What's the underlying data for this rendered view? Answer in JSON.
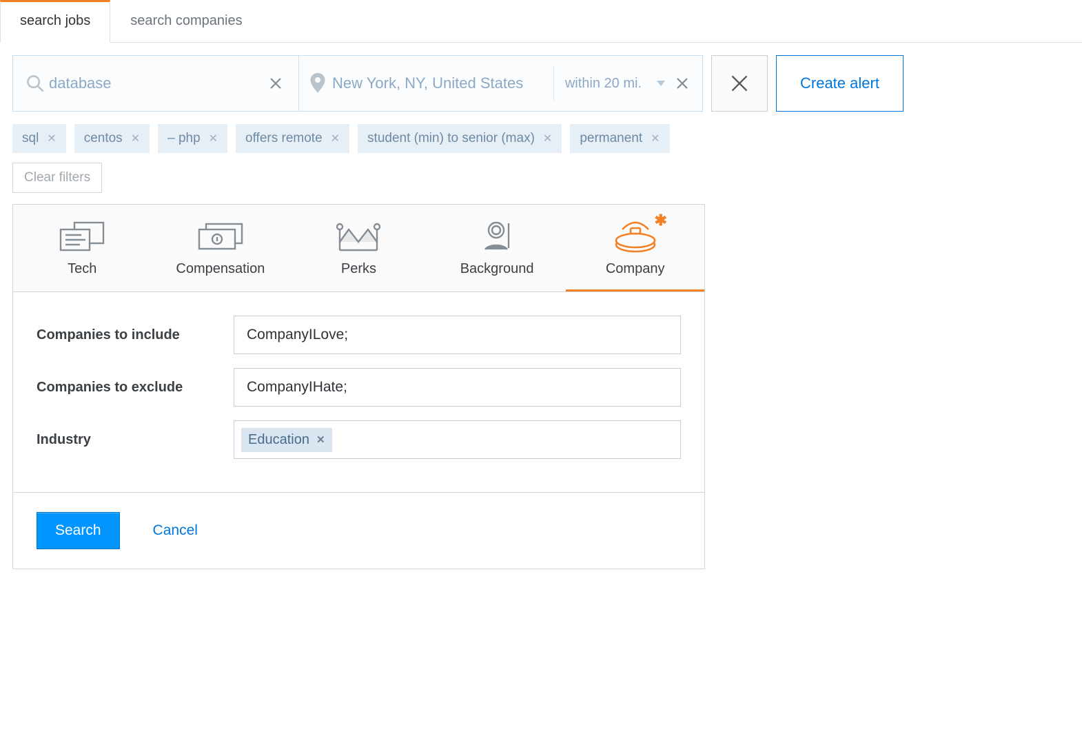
{
  "tabs": {
    "jobs": "search jobs",
    "companies": "search companies"
  },
  "search": {
    "keyword": "database",
    "location": "New York, NY, United States",
    "distance": "within 20 mi."
  },
  "create_alert_label": "Create alert",
  "filter_chips": [
    "sql",
    "centos",
    "– php",
    "offers remote",
    "student (min) to senior (max)",
    "permanent"
  ],
  "clear_filters_label": "Clear filters",
  "filter_tabs": {
    "tech": "Tech",
    "compensation": "Compensation",
    "perks": "Perks",
    "background": "Background",
    "company": "Company"
  },
  "company_panel": {
    "include_label": "Companies to include",
    "include_value": "CompanyILove;",
    "exclude_label": "Companies to exclude",
    "exclude_value": "CompanyIHate;",
    "industry_label": "Industry",
    "industry_tag": "Education"
  },
  "footer": {
    "search": "Search",
    "cancel": "Cancel"
  }
}
